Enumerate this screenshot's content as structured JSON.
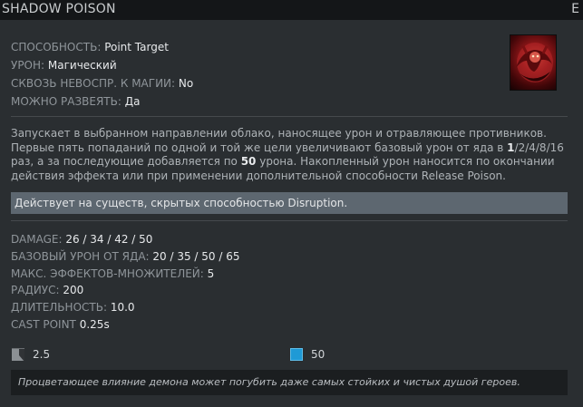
{
  "header": {
    "title": "SHADOW POISON",
    "hotkey": "E"
  },
  "info": {
    "ability_label": "СПОСОБНОСТЬ:",
    "ability_value": "Point Target",
    "damage_label": "УРОН:",
    "damage_value": "Магический",
    "pierce_label": "СКВОЗЬ НЕВОСПР. К МАГИИ:",
    "pierce_value": "No",
    "dispel_label": "МОЖНО РАЗВЕЯТЬ:",
    "dispel_value": "Да"
  },
  "icon": {
    "name": "shadow-poison-icon"
  },
  "description": {
    "part1": "Запускает в выбранном направлении облако, наносящее урон и отравляющее противников. Первые пять попаданий по одной и той же цели увеличивают базовый урон от яда в ",
    "bold1": "1",
    "part2": "/2/4/8/16 раз, а за последующие добавляется по ",
    "bold2": "50",
    "part3": " урона. Накопленный урон наносится по окончании действия эффекта или при применении дополнительной способности Release Poison."
  },
  "note": "Действует на существ, скрытых способностью Disruption.",
  "stats": {
    "damage_label": "DAMAGE:",
    "damage_value": "26 / 34 / 42 / 50",
    "base_poison_label": "БАЗОВЫЙ УРОН ОТ ЯДА:",
    "base_poison_value": "20 / 35 / 50 / 65",
    "max_stacks_label": "МАКС. ЭФФЕКТОВ-МНОЖИТЕЛЕЙ:",
    "max_stacks_value": "5",
    "radius_label": "РАДИУС:",
    "radius_value": "200",
    "duration_label": "ДЛИТЕЛЬНОСТЬ:",
    "duration_value": "10.0",
    "cast_point_label": "CAST POINT",
    "cast_point_value": "0.25s"
  },
  "costs": {
    "cooldown": "2.5",
    "mana": "50"
  },
  "lore": "Процветающее влияние демона может погубить даже самых стойких и чистых душой героев.",
  "colors": {
    "background": "#2a2e31",
    "header": "#141618",
    "note_bg": "#5d6770",
    "mana": "#1f9ad6"
  }
}
